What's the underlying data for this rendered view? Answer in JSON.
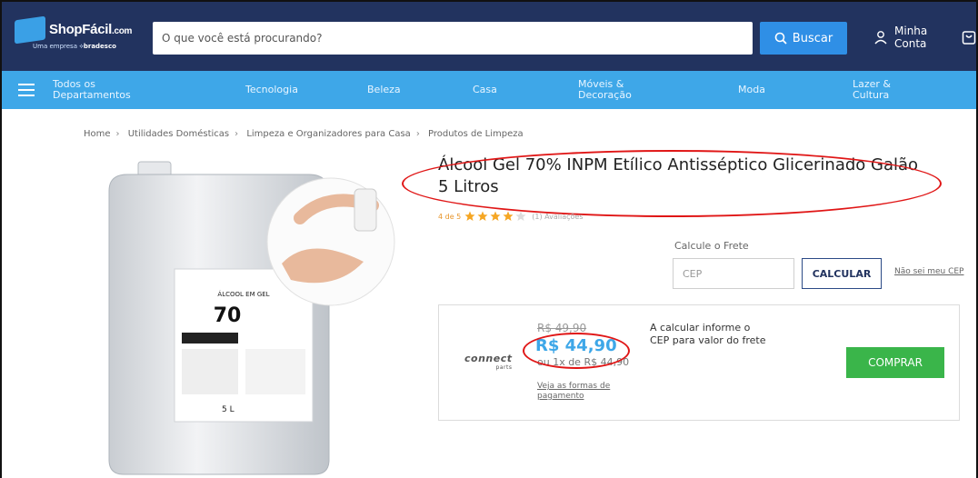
{
  "colors": {
    "header_bg": "#22335f",
    "nav_bg": "#3ea7e8",
    "accent_blue": "#2f8fe6",
    "buy_green": "#3ab54a",
    "star": "#f5a623",
    "annotation_red": "#e01616"
  },
  "header": {
    "logo_text": "ShopFácil",
    "logo_suffix": ".com",
    "logo_tagline": "Uma empresa",
    "logo_partner": "bradesco",
    "search_placeholder": "O que você está procurando?",
    "search_button": "Buscar",
    "account_line1": "Minha",
    "account_line2": "Conta",
    "icons": [
      "search-icon",
      "user-icon",
      "cart-icon"
    ]
  },
  "nav": {
    "all_departments_line1": "Todos os",
    "all_departments_line2": "Departamentos",
    "items": [
      {
        "line1": "Tecnologia",
        "line2": ""
      },
      {
        "line1": "Beleza",
        "line2": ""
      },
      {
        "line1": "Casa",
        "line2": ""
      },
      {
        "line1": "Móveis &",
        "line2": "Decoração"
      },
      {
        "line1": "Moda",
        "line2": ""
      },
      {
        "line1": "Lazer &",
        "line2": "Cultura"
      }
    ]
  },
  "breadcrumb": [
    "Home",
    "Utilidades Domésticas",
    "Limpeza e Organizadores para Casa",
    "Produtos de Limpeza"
  ],
  "product": {
    "title": "Álcool Gel 70% INPM Etílico Antisséptico Glicerinado Galão 5 Litros",
    "rating_text": "4 de 5",
    "rating_value": 4,
    "rating_max": 5,
    "reviews_text": "(1) Avaliações",
    "label_alcool": "ÁLCOOL EM GEL",
    "label_70": "70",
    "label_volume": "5 L"
  },
  "shipping": {
    "label": "Calcule o Frete",
    "cep_placeholder": "CEP",
    "calculate_button": "CALCULAR",
    "dont_know_link": "Não sei meu CEP"
  },
  "offer": {
    "seller": "connect",
    "seller_sub": "parts",
    "old_price": "R$ 49,90",
    "price": "R$ 44,90",
    "installments": "ou 1x de R$ 44,90",
    "payment_link": "Veja as formas de pagamento",
    "shipping_note": "A calcular informe o CEP para valor do frete",
    "buy_button": "COMPRAR"
  }
}
